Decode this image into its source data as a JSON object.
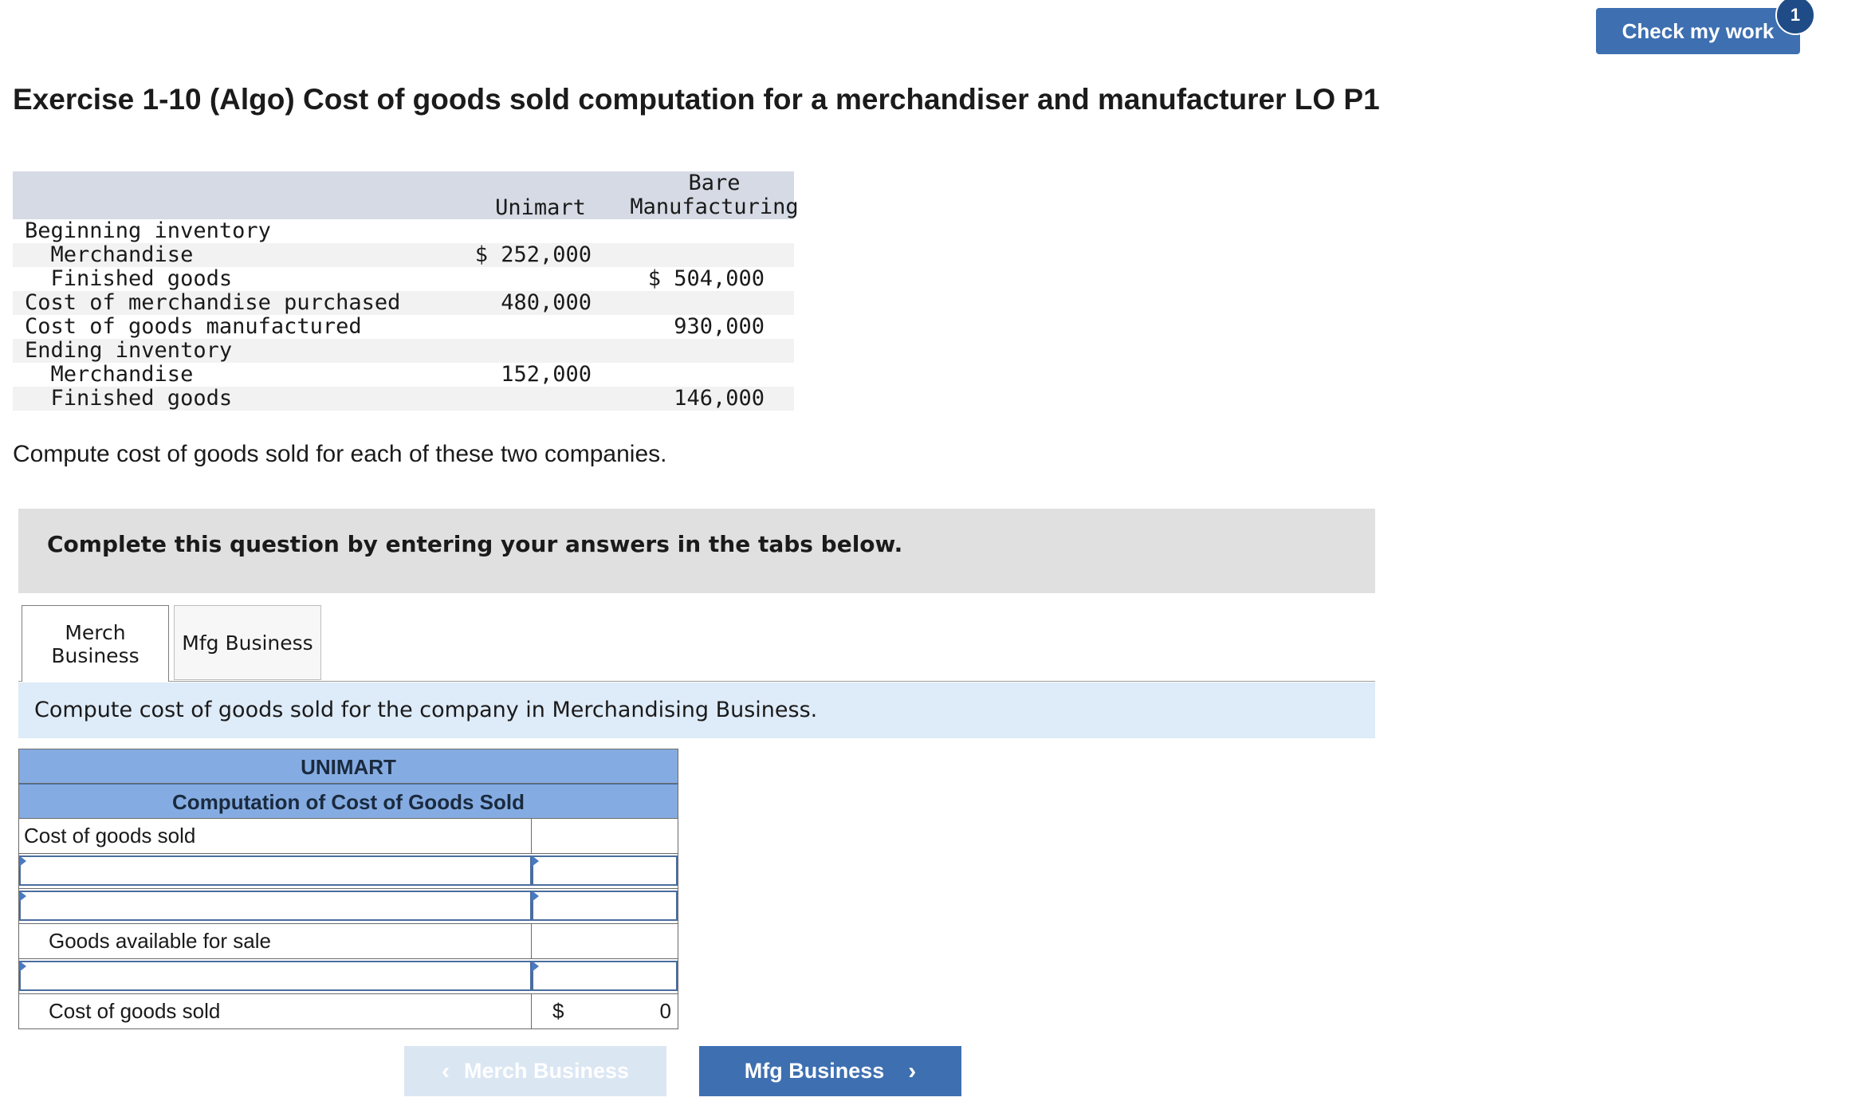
{
  "header": {
    "check_label": "Check my work",
    "check_badge": "1"
  },
  "title": "Exercise 1-10 (Algo) Cost of goods sold computation for a merchandiser and manufacturer LO P1",
  "data_table": {
    "col1": "Unimart",
    "col2_line1": "Bare",
    "col2_line2": "Manufacturing",
    "rows": [
      {
        "label": "Beginning inventory",
        "v1": "",
        "v2": ""
      },
      {
        "label": "  Merchandise",
        "v1": "$ 252,000",
        "v2": ""
      },
      {
        "label": "  Finished goods",
        "v1": "",
        "v2": "$ 504,000"
      },
      {
        "label": "Cost of merchandise purchased",
        "v1": "480,000",
        "v2": ""
      },
      {
        "label": "Cost of goods manufactured",
        "v1": "",
        "v2": "930,000"
      },
      {
        "label": "Ending inventory",
        "v1": "",
        "v2": ""
      },
      {
        "label": "  Merchandise",
        "v1": "152,000",
        "v2": ""
      },
      {
        "label": "  Finished goods",
        "v1": "",
        "v2": "146,000"
      }
    ]
  },
  "instruction": "Compute cost of goods sold for each of these two companies.",
  "banner": "Complete this question by entering your answers in the tabs below.",
  "tabs": {
    "merch_line1": "Merch",
    "merch_line2": "Business",
    "mfg": "Mfg Business"
  },
  "tab_instruction": "Compute cost of goods sold for the company in Merchandising Business.",
  "worksheet": {
    "company": "UNIMART",
    "subtitle": "Computation of Cost of Goods Sold",
    "row1_label": "Cost of goods sold",
    "available_label": "Goods available for sale",
    "total_label": "Cost of goods sold",
    "currency": "$",
    "total_value": "0"
  },
  "nav": {
    "prev_label": "Merch Business",
    "next_label": "Mfg Business"
  }
}
